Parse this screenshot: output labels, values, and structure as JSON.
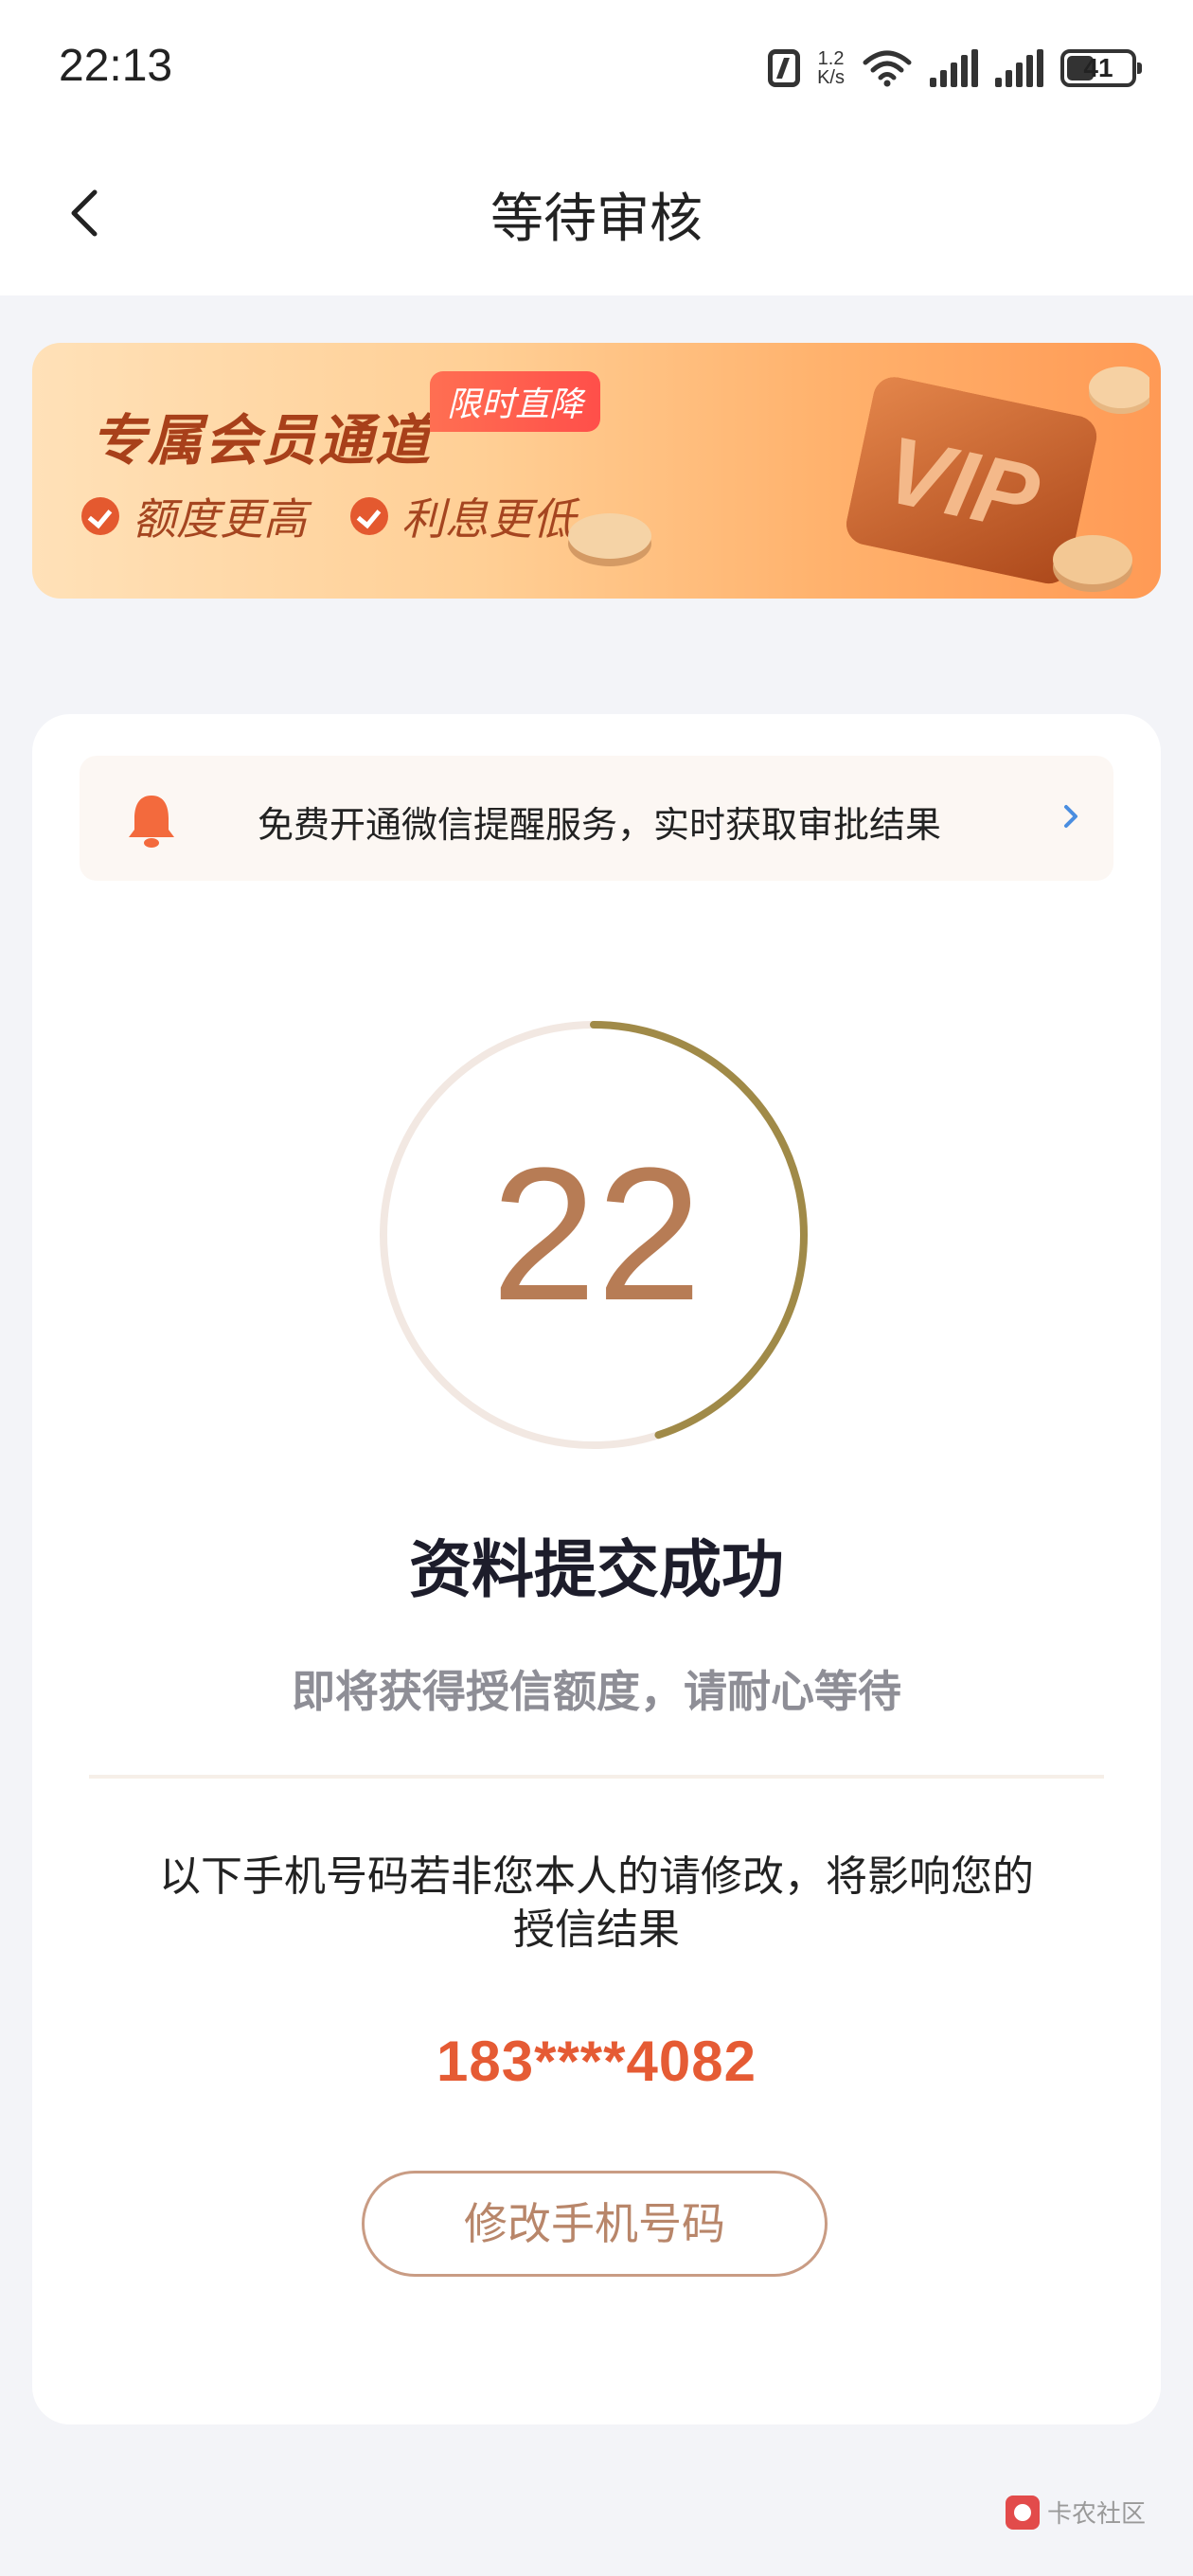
{
  "status_bar": {
    "time": "22:13",
    "net_speed_value": "1.2",
    "net_speed_unit": "K/s",
    "battery": "41"
  },
  "nav": {
    "title": "等待审核",
    "back_icon": "chevron-left-icon"
  },
  "banner": {
    "title": "专属会员通道",
    "tag": "限时直降",
    "benefits": [
      "额度更高",
      "利息更低"
    ],
    "card_text": "VIP"
  },
  "notice": {
    "text": "免费开通微信提醒服务，实时获取审批结果",
    "icon": "bell-icon",
    "arrow_icon": "chevron-right-icon"
  },
  "countdown": {
    "value": "22",
    "progress_fraction": 0.45,
    "color_track": "#f2e8e2",
    "color_progress": "#a08a48"
  },
  "result": {
    "title": "资料提交成功",
    "subtitle": "即将获得授信额度，请耐心等待"
  },
  "phone": {
    "note": "以下手机号码若非您本人的请修改，将影响您的授信结果",
    "number": "183****4082",
    "modify_button": "修改手机号码"
  },
  "watermark": {
    "text": "卡农社区"
  },
  "colors": {
    "accent": "#e55b34",
    "background": "#f3f4f8"
  }
}
